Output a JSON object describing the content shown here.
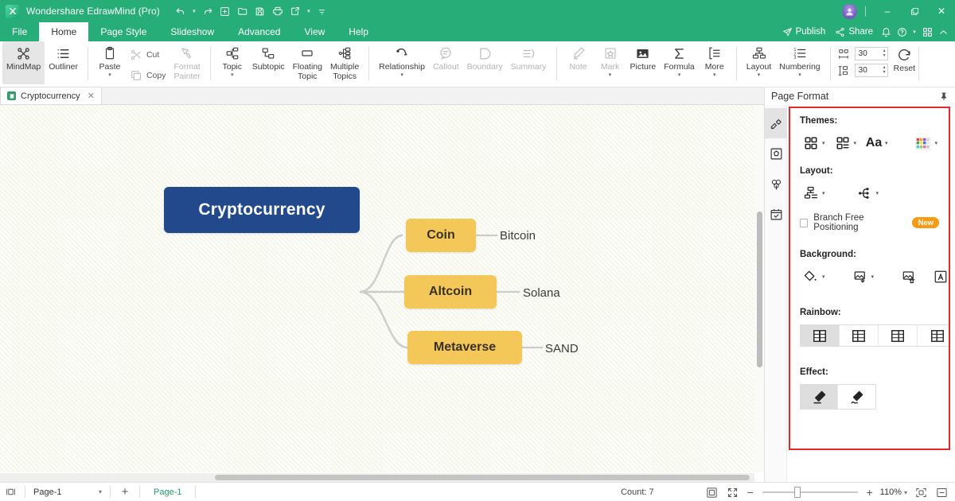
{
  "titlebar": {
    "app_name": "Wondershare EdrawMind (Pro)",
    "logo_icon": "edrawmind-logo-icon",
    "quick_access": [
      {
        "name": "undo",
        "icon": "undo-arrow-icon",
        "caret": true
      },
      {
        "name": "redo",
        "icon": "redo-arrow-icon",
        "caret": false
      },
      {
        "name": "new",
        "icon": "new-file-icon",
        "caret": false
      },
      {
        "name": "open",
        "icon": "folder-open-icon",
        "caret": false
      },
      {
        "name": "save",
        "icon": "save-disk-icon",
        "caret": false
      },
      {
        "name": "print",
        "icon": "printer-icon",
        "caret": false
      },
      {
        "name": "export",
        "icon": "export-share-icon",
        "caret": true
      },
      {
        "name": "customize",
        "icon": "more-chevron-icon",
        "caret": false
      }
    ],
    "window_controls": {
      "minimize": "–",
      "restore": "❐",
      "close": "✕"
    }
  },
  "menubar": {
    "items": [
      {
        "label": "File",
        "active": false
      },
      {
        "label": "Home",
        "active": true
      },
      {
        "label": "Page Style",
        "active": false
      },
      {
        "label": "Slideshow",
        "active": false
      },
      {
        "label": "Advanced",
        "active": false
      },
      {
        "label": "View",
        "active": false
      },
      {
        "label": "Help",
        "active": false
      }
    ],
    "right": {
      "publish_label": "Publish",
      "publish_icon": "paper-plane-icon",
      "share_label": "Share",
      "share_icon": "share-nodes-icon",
      "bell_icon": "notification-bell-icon",
      "help_icon": "question-circle-icon",
      "grid_icon": "apps-grid-icon",
      "collapse_icon": "chevron-up-icon"
    }
  },
  "ribbon": {
    "groups": [
      {
        "name": "view-group",
        "buttons": [
          {
            "label": "MindMap",
            "icon": "mindmap-icon",
            "selected": true,
            "disabled": false,
            "caret": false
          },
          {
            "label": "Outliner",
            "icon": "outliner-icon",
            "selected": false,
            "disabled": false,
            "caret": false
          }
        ]
      },
      {
        "name": "clipboard-group",
        "buttons": [
          {
            "label": "Paste",
            "icon": "clipboard-icon",
            "selected": false,
            "disabled": false,
            "caret": true
          },
          {
            "label": "Cut",
            "icon": "scissors-icon",
            "selected": false,
            "disabled": true,
            "caret": false
          },
          {
            "label": "Copy",
            "icon": "copy-icon",
            "selected": false,
            "disabled": true,
            "caret": false
          },
          {
            "label": "Format\nPainter",
            "icon": "format-painter-icon",
            "selected": false,
            "disabled": true,
            "caret": false
          }
        ]
      },
      {
        "name": "topic-group",
        "buttons": [
          {
            "label": "Topic",
            "icon": "topic-icon",
            "selected": false,
            "disabled": false,
            "caret": true
          },
          {
            "label": "Subtopic",
            "icon": "subtopic-icon",
            "selected": false,
            "disabled": false,
            "caret": false
          },
          {
            "label": "Floating\nTopic",
            "icon": "floating-topic-icon",
            "selected": false,
            "disabled": false,
            "caret": false
          },
          {
            "label": "Multiple\nTopics",
            "icon": "multiple-topics-icon",
            "selected": false,
            "disabled": false,
            "caret": false
          }
        ]
      },
      {
        "name": "relation-group",
        "buttons": [
          {
            "label": "Relationship",
            "icon": "relationship-icon",
            "selected": false,
            "disabled": false,
            "caret": true
          },
          {
            "label": "Callout",
            "icon": "callout-icon",
            "selected": false,
            "disabled": true,
            "caret": false
          },
          {
            "label": "Boundary",
            "icon": "boundary-icon",
            "selected": false,
            "disabled": true,
            "caret": false
          },
          {
            "label": "Summary",
            "icon": "summary-icon",
            "selected": false,
            "disabled": true,
            "caret": false
          }
        ]
      },
      {
        "name": "insert-group",
        "buttons": [
          {
            "label": "Note",
            "icon": "note-pencil-icon",
            "selected": false,
            "disabled": true,
            "caret": false
          },
          {
            "label": "Mark",
            "icon": "mark-badge-icon",
            "selected": false,
            "disabled": true,
            "caret": true
          },
          {
            "label": "Picture",
            "icon": "picture-icon",
            "selected": false,
            "disabled": false,
            "caret": false
          },
          {
            "label": "Formula",
            "icon": "formula-sigma-icon",
            "selected": false,
            "disabled": false,
            "caret": true
          },
          {
            "label": "More",
            "icon": "more-list-icon",
            "selected": false,
            "disabled": false,
            "caret": true
          }
        ]
      },
      {
        "name": "layout-group",
        "buttons": [
          {
            "label": "Layout",
            "icon": "layout-tree-icon",
            "selected": false,
            "disabled": false,
            "caret": true
          },
          {
            "label": "Numbering",
            "icon": "numbering-icon",
            "selected": false,
            "disabled": false,
            "caret": true
          }
        ]
      }
    ],
    "spacing": {
      "horizontal_icon": "horizontal-spacing-icon",
      "horizontal_value": "30",
      "vertical_icon": "vertical-spacing-icon",
      "vertical_value": "30",
      "reset_label": "Reset",
      "reset_icon": "reset-circle-arrow-icon"
    }
  },
  "doctab": {
    "icon": "document-icon",
    "label": "Cryptocurrency",
    "close_icon": "close-icon"
  },
  "mindmap": {
    "root": {
      "text": "Cryptocurrency",
      "color": "#21498c",
      "text_color": "#ffffff"
    },
    "branches": [
      {
        "topic": "Coin",
        "leaf": "Bitcoin",
        "color": "#f3c758"
      },
      {
        "topic": "Altcoin",
        "leaf": "Solana",
        "color": "#f3c758"
      },
      {
        "topic": "Metaverse",
        "leaf": "SAND",
        "color": "#f3c758"
      }
    ]
  },
  "rpanel": {
    "title": "Page Format",
    "pin_icon": "pin-icon",
    "rail": [
      {
        "name": "page-format",
        "icon": "paint-roller-icon",
        "selected": true
      },
      {
        "name": "shape",
        "icon": "pentagon-frame-icon",
        "selected": false
      },
      {
        "name": "clipart",
        "icon": "clover-icon",
        "selected": false
      },
      {
        "name": "tasks",
        "icon": "calendar-check-icon",
        "selected": false
      }
    ],
    "themes": {
      "title": "Themes:",
      "buttons": [
        {
          "name": "theme-gallery",
          "icon": "grid-squares-icon",
          "caret": true
        },
        {
          "name": "theme-variant",
          "icon": "grid-lines-icon",
          "caret": true
        },
        {
          "name": "theme-font",
          "icon": "font-Aa-icon",
          "caret": true
        },
        {
          "name": "theme-colors",
          "icon": "color-palette-icon",
          "caret": true
        }
      ]
    },
    "layout": {
      "title": "Layout:",
      "buttons": [
        {
          "name": "layout-structure",
          "icon": "layout-tree-icon",
          "caret": true
        },
        {
          "name": "branch-style",
          "icon": "branch-style-icon",
          "caret": true
        }
      ],
      "checkbox_label": "Branch Free Positioning",
      "checkbox_checked": false,
      "badge": "New"
    },
    "background": {
      "title": "Background:",
      "buttons": [
        {
          "name": "fill-color",
          "icon": "paint-bucket-icon",
          "caret": true
        },
        {
          "name": "insert-bg-image",
          "icon": "image-download-icon",
          "caret": true
        },
        {
          "name": "delete-bg-image",
          "icon": "image-trash-icon",
          "caret": false
        },
        {
          "name": "watermark",
          "icon": "watermark-A-icon",
          "caret": true
        }
      ]
    },
    "rainbow": {
      "title": "Rainbow:",
      "options": [
        {
          "name": "rainbow-option-1",
          "icon": "rainbow-swatch-1-icon",
          "selected": true
        },
        {
          "name": "rainbow-option-2",
          "icon": "rainbow-swatch-2-icon",
          "selected": false
        },
        {
          "name": "rainbow-option-3",
          "icon": "rainbow-swatch-3-icon",
          "selected": false
        },
        {
          "name": "rainbow-option-4",
          "icon": "rainbow-swatch-4-icon",
          "selected": false
        }
      ]
    },
    "effect": {
      "title": "Effect:",
      "options": [
        {
          "name": "effect-straight",
          "icon": "pencil-straight-icon",
          "selected": true
        },
        {
          "name": "effect-sketch",
          "icon": "pencil-sketch-icon",
          "selected": false
        }
      ]
    },
    "highlight_color": "#e8282c"
  },
  "statusbar": {
    "view_icon": "page-view-icon",
    "page_select_value": "Page-1",
    "page_select_caret": "▾",
    "add_page_icon": "plus-icon",
    "active_page": "Page-1",
    "count_label": "Count: 7",
    "fit_page_icon": "fit-page-icon",
    "full_screen_icon": "fullscreen-icon",
    "zoom_out_icon": "minus-icon",
    "zoom_in_icon": "plus-icon",
    "zoom_value": "110%",
    "zoom_caret": "▾",
    "focus_icon": "focus-icon",
    "minimize_panel_icon": "collapse-panel-icon"
  },
  "colors": {
    "brand_green": "#27ae78",
    "root_blue": "#21498c",
    "topic_gold": "#f3c758",
    "panel_highlight": "#e8282c",
    "badge_orange": "#f79a14",
    "active_page_green": "#1f9d63"
  }
}
